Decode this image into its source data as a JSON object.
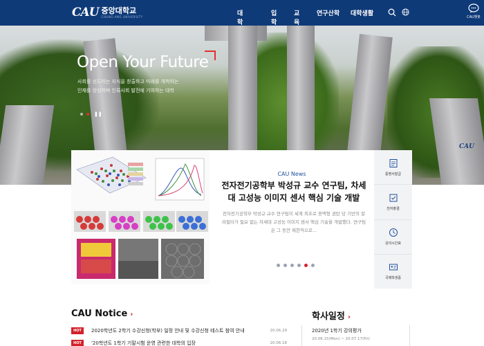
{
  "header": {
    "logo_mark": "CAU",
    "logo_ko": "중앙대학교",
    "logo_en": "CHUNG-ANG UNIVERSITY",
    "nav": [
      "대학소개",
      "입학",
      "교육",
      "연구산학",
      "대학생활"
    ],
    "caubot_label": "CAU챗봇"
  },
  "hero": {
    "title": "Open Your Future",
    "subtitle_lines": [
      "사회를 선도하는 지식을 창출하고 미래를 개척하는",
      "인재를 양성하며 인류사회 발전에 기여하는 대학"
    ],
    "stone_label": "CAU",
    "active_slide": 1,
    "slides": 2
  },
  "news": {
    "label": "CAU News",
    "title": "전자전기공학부 박성규 교수 연구팀, 차세대 고성능 이미지 센서 핵심 기술 개발",
    "body": "전자전기공학부 박성규 교수 연구팀이 세계 최초로 용액형 권탄 당 기반의 칼라필터가 필요 없는 차세대 고성능 이미지 센서 핵심 기술을 개발했다. 연구팀은 그 동안 제한적으로...",
    "active_dot": 5,
    "dots": 6
  },
  "quick": [
    {
      "label": "증명서발급",
      "icon": "certificate-icon"
    },
    {
      "label": "전자출결",
      "icon": "attendance-icon"
    },
    {
      "label": "강의시간표",
      "icon": "clock-icon"
    },
    {
      "label": "국제학생증",
      "icon": "id-card-icon"
    }
  ],
  "notice": {
    "title": "CAU Notice",
    "items": [
      {
        "tag": "HOT",
        "text": "2020학년도 2학기 수강신청(학부) 일정 안내 및 수강신청 테스트 참여 안내",
        "date": "20.06.29"
      },
      {
        "tag": "HOT",
        "text": "'20학년도 1학기 기말시험 운영 관련한 대학의 입장",
        "date": "20.06.18"
      }
    ]
  },
  "schedule": {
    "title": "학사일정",
    "name": "2020년 1학기 강의평가",
    "date": "20.06.15(Mon) ~ 20.07.17(Fri)"
  },
  "colors": {
    "primary": "#0f3a78",
    "accent": "#d4202a"
  }
}
